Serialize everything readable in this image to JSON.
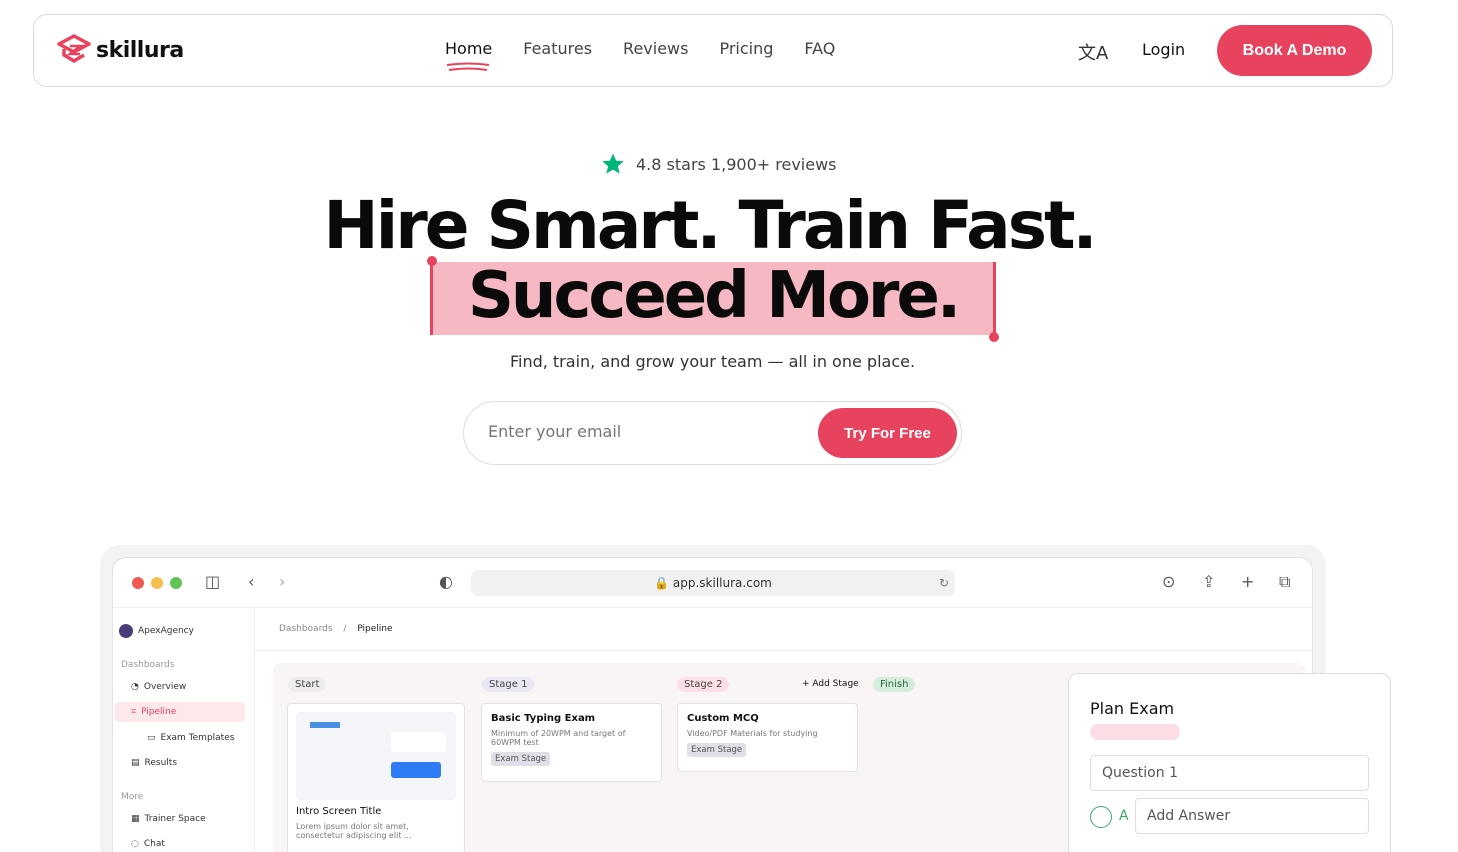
{
  "brand": {
    "name": "skillura"
  },
  "nav": {
    "links": [
      "Home",
      "Features",
      "Reviews",
      "Pricing",
      "FAQ"
    ],
    "login": "Login",
    "cta": "Book A Demo"
  },
  "hero": {
    "rating": "4.8 stars 1,900+ reviews",
    "headline_line1": "Hire Smart. Train Fast.",
    "headline_line2": "Succeed More.",
    "subtitle": "Find, train, and grow your team — all in one place.",
    "email_placeholder": "Enter your email",
    "cta": "Try For Free"
  },
  "colors": {
    "accent": "#e8435e",
    "highlight": "#f6b8c3",
    "star": "#00b67a"
  },
  "app": {
    "url": "app.skillura.com",
    "workspace": "ApexAgency",
    "sidebar": {
      "dashboards_heading": "Dashboards",
      "items": [
        "Overview",
        "Pipeline",
        "Exam Templates",
        "Results"
      ],
      "more_heading": "More",
      "more_items": [
        "Trainer Space",
        "Chat"
      ]
    },
    "breadcrumb": {
      "root": "Dashboards",
      "sep": "/",
      "current": "Pipeline"
    },
    "stages": [
      "Start",
      "Stage 1",
      "Stage 2",
      "Finish"
    ],
    "add_stage": "+ Add Stage",
    "cards": [
      {
        "title": "Intro Screen Title",
        "desc": "Lorem ipsum dolor sit amet, consectetur adipiscing elit ..."
      },
      {
        "title": "Basic Typing Exam",
        "desc": "Minimum of 20WPM and target of 60WPM test",
        "tag": "Exam Stage"
      },
      {
        "title": "Custom MCQ",
        "desc": "Video/PDF Materials for studying",
        "tag": "Exam Stage"
      }
    ],
    "plan": {
      "title": "Plan Exam",
      "question_placeholder": "Question 1",
      "option_letter": "A",
      "answer_placeholder": "Add Answer"
    }
  }
}
